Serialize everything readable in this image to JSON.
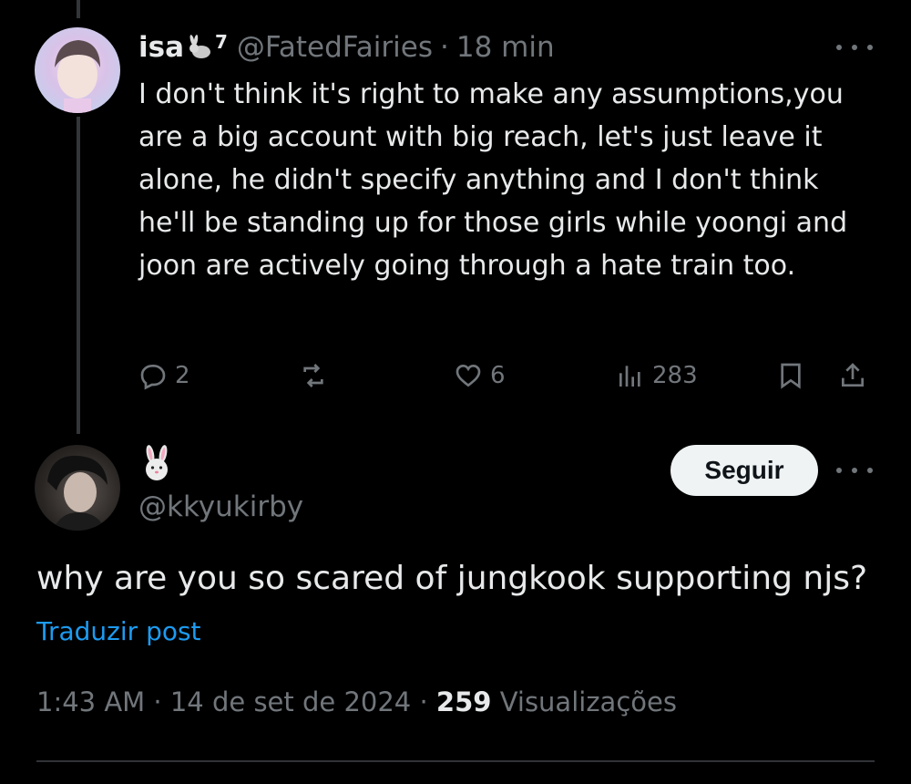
{
  "colors": {
    "background": "#000000",
    "primary_text": "#e7e9ea",
    "muted_text": "#71767b",
    "link": "#1d9bf0",
    "button_bg": "#eff3f4",
    "button_text": "#0f1419",
    "thread_line": "#333639"
  },
  "reply": {
    "display_name": "isa",
    "name_emoji": "rabbit",
    "name_suffix": "7",
    "handle": "@FatedFairies",
    "separator": "·",
    "time": "18 min",
    "text": "I don't think it's right to make any assumptions,you are a big account with big reach, let's just leave it alone, he didn't specify anything and I don't think he'll be standing up for those girls while yoongi and joon are actively going through a hate train too.",
    "actions": {
      "replies": "2",
      "reposts": "",
      "likes": "6",
      "views": "283"
    },
    "icons": {
      "reply": "reply-icon",
      "repost": "repost-icon",
      "like": "heart-icon",
      "views": "views-bar-icon",
      "bookmark": "bookmark-icon",
      "share": "share-icon",
      "more": "more-icon"
    }
  },
  "main_post": {
    "display_name_emoji": "rabbit-face",
    "handle": "@kkyukirby",
    "follow_label": "Seguir",
    "text": "why are you so scared of jungkook supporting njs?",
    "translate_label": "Traduzir post",
    "time": "1:43 AM",
    "sep1": "·",
    "date": "14 de set de 2024",
    "sep2": "·",
    "views_count": "259",
    "views_label": "Visualizações"
  }
}
